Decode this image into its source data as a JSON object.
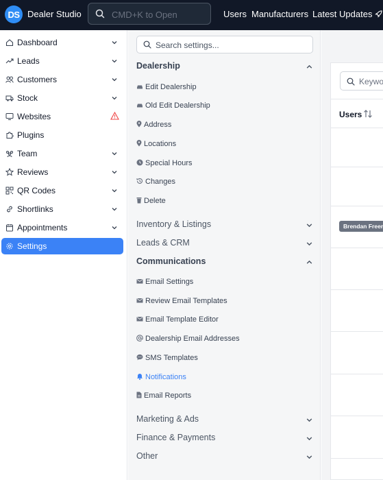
{
  "header": {
    "logo_text": "DS",
    "brand": "Dealer Studio",
    "search_placeholder": "CMD+K to Open",
    "nav": [
      "Users",
      "Manufacturers",
      "Latest Updates"
    ]
  },
  "sidebar": {
    "items": [
      {
        "label": "Dashboard",
        "icon": "home-icon",
        "chevron": true
      },
      {
        "label": "Leads",
        "icon": "trend-icon",
        "chevron": true
      },
      {
        "label": "Customers",
        "icon": "users-icon",
        "chevron": true
      },
      {
        "label": "Stock",
        "icon": "truck-icon",
        "chevron": true
      },
      {
        "label": "Websites",
        "icon": "monitor-icon",
        "chevron": false,
        "warning": true
      },
      {
        "label": "Plugins",
        "icon": "puzzle-icon",
        "chevron": false
      },
      {
        "label": "Team",
        "icon": "team-icon",
        "chevron": true
      },
      {
        "label": "Reviews",
        "icon": "star-icon",
        "chevron": true
      },
      {
        "label": "QR Codes",
        "icon": "qr-icon",
        "chevron": true
      },
      {
        "label": "Shortlinks",
        "icon": "link-icon",
        "chevron": true
      },
      {
        "label": "Appointments",
        "icon": "calendar-icon",
        "chevron": true
      },
      {
        "label": "Settings",
        "icon": "gear-icon",
        "chevron": false,
        "active": true
      }
    ]
  },
  "settings": {
    "search_placeholder": "Search settings...",
    "dealership": {
      "title": "Dealership",
      "items": [
        "Edit Dealership",
        "Old Edit Dealership",
        "Address",
        "Locations",
        "Special Hours",
        "Changes",
        "Delete"
      ]
    },
    "inventory": "Inventory & Listings",
    "leads_crm": "Leads & CRM",
    "communications": {
      "title": "Communications",
      "items": [
        "Email Settings",
        "Review Email Templates",
        "Email Template Editor",
        "Dealership Email Addresses",
        "SMS Templates",
        "Notifications",
        "Email Reports"
      ]
    },
    "marketing": "Marketing & Ads",
    "finance": "Finance & Payments",
    "other": "Other"
  },
  "content": {
    "keyword_placeholder": "Keywo",
    "users_header": "Users",
    "badge": "Brendan Freem"
  },
  "colors": {
    "topbar": "#111827",
    "accent": "#3b82f6",
    "warning": "#ef4444"
  }
}
